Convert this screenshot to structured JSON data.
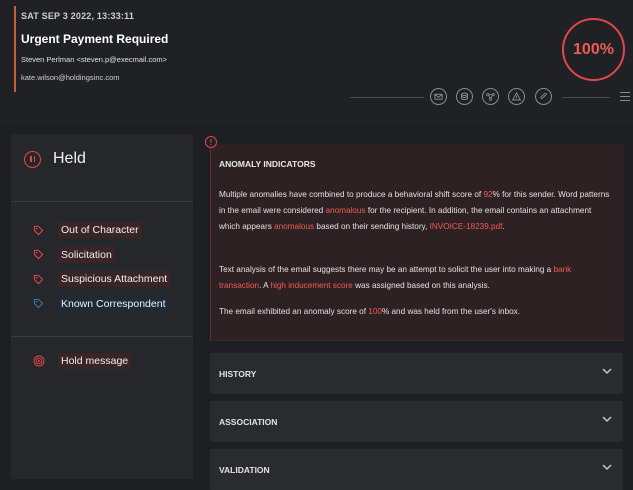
{
  "email": {
    "date": "SAT SEP 3 2022, 13:33:11",
    "subject": "Urgent Payment Required",
    "sender": "Steven Perlman <steven.p@execmail.com>",
    "recipient": "kate.wilson@holdingsinc.com",
    "score": "100%"
  },
  "header_icons": [
    "envelope-icon",
    "database-icon",
    "network-icon",
    "warning-icon",
    "paperclip-icon",
    "menu-icon"
  ],
  "status": {
    "label": "Held",
    "icon": "pause-icon"
  },
  "tags": [
    {
      "label": "Out of Character",
      "icon": "tag-icon",
      "color": "#e0474c"
    },
    {
      "label": "Solicitation",
      "icon": "tag-icon",
      "color": "#e0474c"
    },
    {
      "label": "Suspicious Attachment",
      "icon": "tag-icon",
      "color": "#e0474c"
    },
    {
      "label": "Known Correspondent",
      "icon": "tag-icon",
      "color": "#3e78b5"
    }
  ],
  "action": {
    "label": "Hold message",
    "icon": "target-icon"
  },
  "anomaly": {
    "title": "ANOMALY INDICATORS",
    "p1": {
      "t1": "Multiple anomalies have combined to produce a behavioral shift score of ",
      "h1": "92",
      "t2": "% for this sender. Word patterns in the email were considered ",
      "h2": "anomalous",
      "t3": " for the recipient. In addition, the email contains an attachment which appears ",
      "h3": "anomalous",
      "t4": " based on their sending history, ",
      "h4": "INVOICE-18239.pdf",
      "t5": "."
    },
    "p2": {
      "t1": "Text analysis of the email suggests there may be an attempt to solicit the user into making a ",
      "h1": "bank transaction",
      "t2": ". A ",
      "h2": "high inducement score",
      "t3": " was assigned based on this analysis."
    },
    "p3": {
      "t1": "The email exhibited an anomaly score of ",
      "h1": "100",
      "t2": "% and was held from the user's inbox."
    }
  },
  "sections": [
    {
      "label": "HISTORY"
    },
    {
      "label": "ASSOCIATION"
    },
    {
      "label": "VALIDATION"
    }
  ],
  "colors": {
    "accent_red": "#e0474c",
    "highlight": "#ef5a57",
    "info_blue": "#3e78b5",
    "background": "#1e1f22"
  }
}
